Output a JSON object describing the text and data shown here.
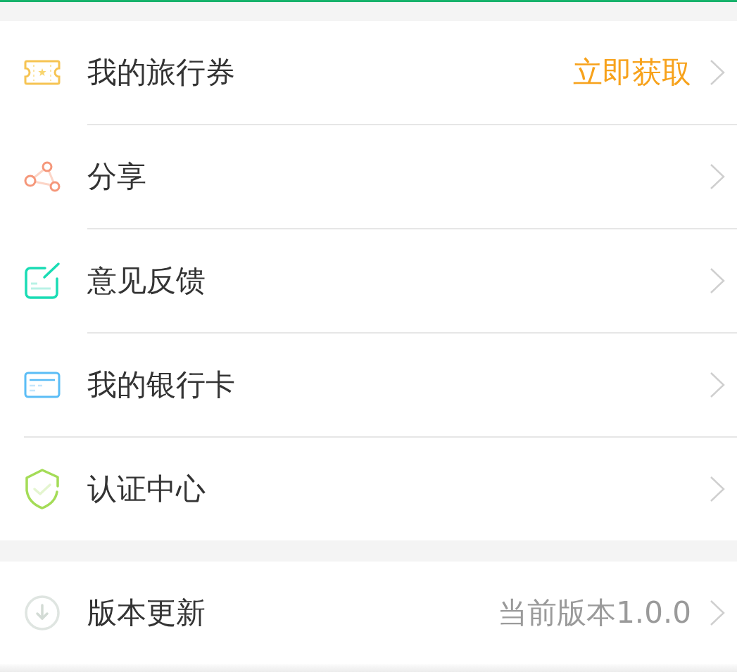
{
  "groups": [
    {
      "items": [
        {
          "kind": "ticket",
          "label": "我的旅行券",
          "value": {
            "text": "立即获取",
            "kind": "promo"
          },
          "divider": {
            "indented": true
          }
        },
        {
          "kind": "share",
          "label": "分享",
          "divider": {
            "indented": true
          }
        },
        {
          "kind": "feedback",
          "label": "意见反馈",
          "divider": {
            "indented": true
          }
        },
        {
          "kind": "card",
          "label": "我的银行卡",
          "divider": {
            "indented": false
          }
        },
        {
          "kind": "shield",
          "label": "认证中心"
        }
      ]
    },
    {
      "items": [
        {
          "kind": "update",
          "label": "版本更新",
          "value": {
            "text": "当前版本1.0.0",
            "kind": "info"
          }
        }
      ]
    }
  ]
}
